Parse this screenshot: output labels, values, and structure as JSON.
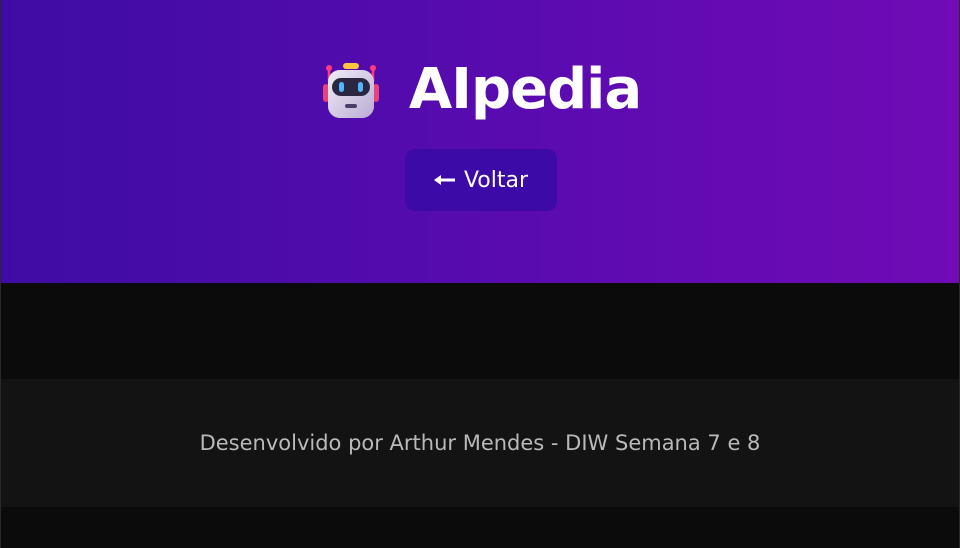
{
  "header": {
    "logo_icon": "robot-icon",
    "title": "AIpedia",
    "gradient_start": "#3e0ca4",
    "gradient_end": "#700bb6"
  },
  "nav": {
    "back_button_label": "Voltar",
    "back_button_icon": "arrow-left-icon",
    "back_button_color": "#3c0aa6"
  },
  "footer": {
    "text": "Desenvolvido por Arthur Mendes - DIW Semana 7 e 8"
  }
}
